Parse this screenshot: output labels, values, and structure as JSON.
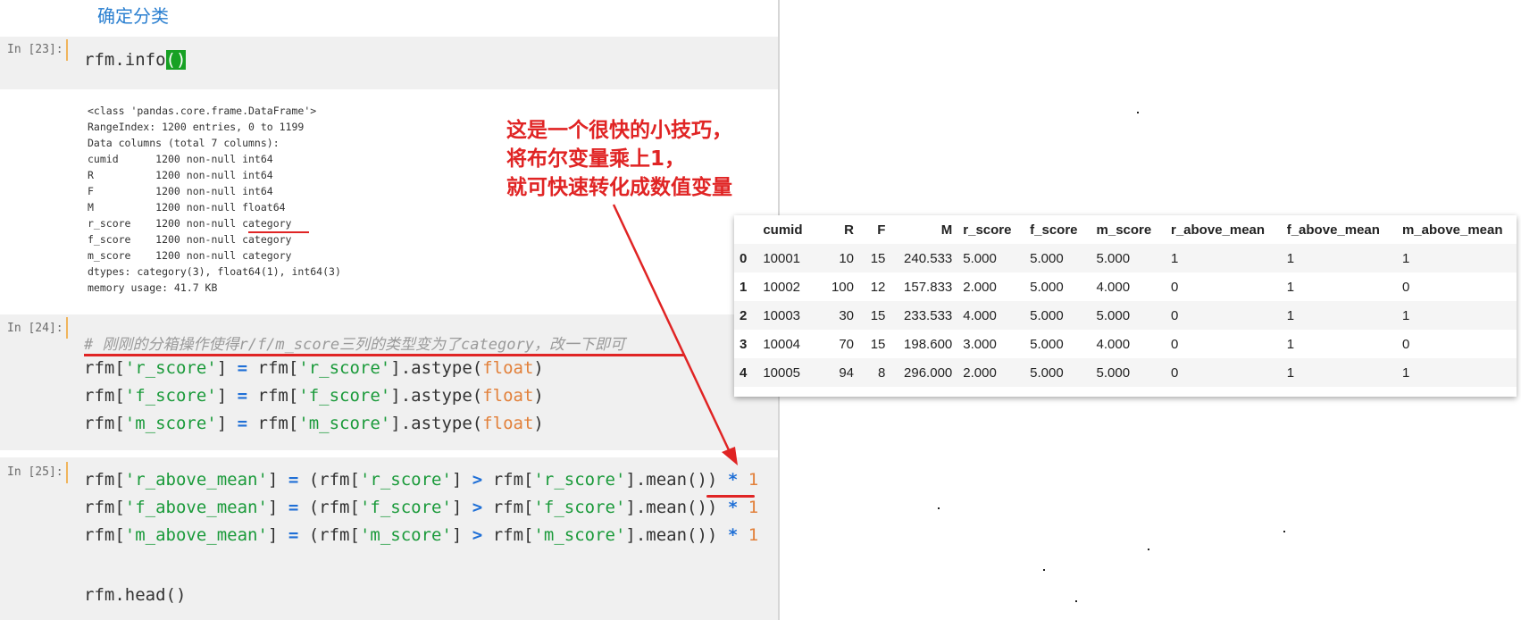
{
  "heading": "确定分类",
  "cells": {
    "c23": {
      "prompt": "In [23]:",
      "code_prefix": "rfm.info",
      "code_paren": "()"
    },
    "c23_output": [
      "<class 'pandas.core.frame.DataFrame'>",
      "RangeIndex: 1200 entries, 0 to 1199",
      "Data columns (total 7 columns):",
      "cumid      1200 non-null int64",
      "R          1200 non-null int64",
      "F          1200 non-null int64",
      "M          1200 non-null float64",
      "r_score    1200 non-null category",
      "f_score    1200 non-null category",
      "m_score    1200 non-null category",
      "dtypes: category(3), float64(1), int64(3)",
      "memory usage: 41.7 KB"
    ],
    "c24": {
      "prompt": "In [24]:",
      "comment": "# 刚刚的分箱操作使得r/f/m_score三列的类型变为了category，改一下即可",
      "lines": [
        {
          "lhs_pre": "rfm[",
          "lhs_str": "'r_score'",
          "lhs_post": "]",
          "eq": "=",
          "rhs_pre": "rfm[",
          "rhs_str": "'r_score'",
          "rhs_post": "].astype(",
          "builtin": "float",
          "tail": ")"
        },
        {
          "lhs_pre": "rfm[",
          "lhs_str": "'f_score'",
          "lhs_post": "]",
          "eq": "=",
          "rhs_pre": "rfm[",
          "rhs_str": "'f_score'",
          "rhs_post": "].astype(",
          "builtin": "float",
          "tail": ")"
        },
        {
          "lhs_pre": "rfm[",
          "lhs_str": "'m_score'",
          "lhs_post": "]",
          "eq": "=",
          "rhs_pre": "rfm[",
          "rhs_str": "'m_score'",
          "rhs_post": "].astype(",
          "builtin": "float",
          "tail": ")"
        }
      ]
    },
    "c25": {
      "prompt": "In [25]:",
      "lines": [
        {
          "lhs_pre": "rfm[",
          "lhs_str": "'r_above_mean'",
          "lhs_post": "]",
          "eq": "=",
          "a": "(rfm[",
          "a_str": "'r_score'",
          "a_post": "]",
          "gt": ">",
          "b": "rfm[",
          "b_str": "'r_score'",
          "b_post": "].mean())",
          "mul": "*",
          "one": "1"
        },
        {
          "lhs_pre": "rfm[",
          "lhs_str": "'f_above_mean'",
          "lhs_post": "]",
          "eq": "=",
          "a": "(rfm[",
          "a_str": "'f_score'",
          "a_post": "]",
          "gt": ">",
          "b": "rfm[",
          "b_str": "'f_score'",
          "b_post": "].mean())",
          "mul": "*",
          "one": "1"
        },
        {
          "lhs_pre": "rfm[",
          "lhs_str": "'m_above_mean'",
          "lhs_post": "]",
          "eq": "=",
          "a": "(rfm[",
          "a_str": "'m_score'",
          "a_post": "]",
          "gt": ">",
          "b": "rfm[",
          "b_str": "'m_score'",
          "b_post": "].mean())",
          "mul": "*",
          "one": "1"
        }
      ],
      "last_line": "rfm.head()"
    }
  },
  "annotation": {
    "lines": [
      "这是一个很快的小技巧，",
      "将布尔变量乘上1，",
      "就可快速转化成数值变量"
    ],
    "color": "#e02424"
  },
  "dataframe": {
    "columns": [
      "",
      "cumid",
      "R",
      "F",
      "M",
      "r_score",
      "f_score",
      "m_score",
      "r_above_mean",
      "f_above_mean",
      "m_above_mean"
    ],
    "rows": [
      [
        "0",
        "10001",
        "10",
        "15",
        "240.533",
        "5.000",
        "5.000",
        "5.000",
        "1",
        "1",
        "1"
      ],
      [
        "1",
        "10002",
        "100",
        "12",
        "157.833",
        "2.000",
        "5.000",
        "4.000",
        "0",
        "1",
        "0"
      ],
      [
        "2",
        "10003",
        "30",
        "15",
        "233.533",
        "4.000",
        "5.000",
        "5.000",
        "0",
        "1",
        "1"
      ],
      [
        "3",
        "10004",
        "70",
        "15",
        "198.600",
        "3.000",
        "5.000",
        "4.000",
        "0",
        "1",
        "0"
      ],
      [
        "4",
        "10005",
        "94",
        "8",
        "296.000",
        "2.000",
        "5.000",
        "5.000",
        "0",
        "1",
        "1"
      ]
    ]
  }
}
